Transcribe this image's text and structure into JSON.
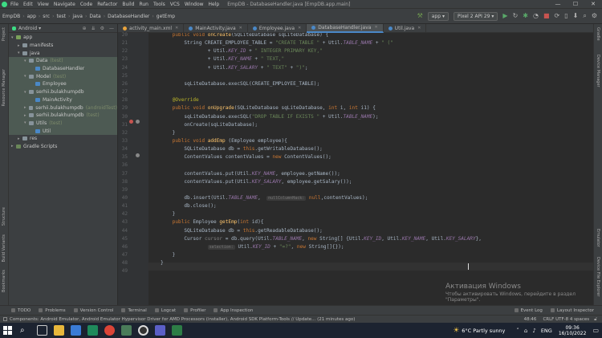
{
  "menu": {
    "app_icon": "android-studio-icon",
    "items": [
      "File",
      "Edit",
      "View",
      "Navigate",
      "Code",
      "Refactor",
      "Build",
      "Run",
      "Tools",
      "VCS",
      "Window",
      "Help"
    ],
    "title": "EmpDB - DatabaseHandler.java [EmpDB.app.main]",
    "window_controls": [
      "—",
      "☐",
      "✕"
    ]
  },
  "nav": {
    "breadcrumbs": [
      "EmpDB",
      "app",
      "src",
      "test",
      "java",
      "Data",
      "DatabaseHandler",
      "getEmp"
    ],
    "config": "app",
    "device": "Pixel 2 API 29"
  },
  "left_stripe": {
    "labels": [
      "Project",
      "Resource Manager",
      "Structure",
      "Build Variants",
      "Bookmarks"
    ]
  },
  "right_stripe": {
    "labels": [
      "Gradle",
      "Device Manager",
      "Emulator",
      "Device File Explorer"
    ]
  },
  "project": {
    "selector": "Android",
    "tree": [
      {
        "label": "app",
        "secondary": "",
        "depth": 0,
        "arrow": "▾",
        "icon": "#7aa05a",
        "sel": false
      },
      {
        "label": "manifests",
        "secondary": "",
        "depth": 1,
        "arrow": "▸",
        "icon": "#87939a",
        "sel": false
      },
      {
        "label": "java",
        "secondary": "",
        "depth": 1,
        "arrow": "▾",
        "icon": "#87939a",
        "sel": false
      },
      {
        "label": "Data",
        "secondary": "(test)",
        "depth": 2,
        "arrow": "▾",
        "icon": "#87939a",
        "sel": true
      },
      {
        "label": "DatabaseHandler",
        "secondary": "",
        "depth": 3,
        "arrow": "",
        "icon": "#4a88c7",
        "sel": true
      },
      {
        "label": "Model",
        "secondary": "(test)",
        "depth": 2,
        "arrow": "▾",
        "icon": "#87939a",
        "sel": true
      },
      {
        "label": "Employee",
        "secondary": "",
        "depth": 3,
        "arrow": "",
        "icon": "#4a88c7",
        "sel": true
      },
      {
        "label": "serhii.bulakhumpdb",
        "secondary": "",
        "depth": 2,
        "arrow": "▾",
        "icon": "#87939a",
        "sel": true
      },
      {
        "label": "MainActivity",
        "secondary": "",
        "depth": 3,
        "arrow": "",
        "icon": "#4a88c7",
        "sel": true
      },
      {
        "label": "serhii.bulakhumpdb",
        "secondary": "(androidTest)",
        "depth": 2,
        "arrow": "▸",
        "icon": "#87939a",
        "sel": true
      },
      {
        "label": "serhii.bulakhumpdb",
        "secondary": "(test)",
        "depth": 2,
        "arrow": "▸",
        "icon": "#87939a",
        "sel": true
      },
      {
        "label": "Utils",
        "secondary": "(test)",
        "depth": 2,
        "arrow": "▾",
        "icon": "#87939a",
        "sel": true
      },
      {
        "label": "Util",
        "secondary": "",
        "depth": 3,
        "arrow": "",
        "icon": "#4a88c7",
        "sel": true
      },
      {
        "label": "res",
        "secondary": "",
        "depth": 1,
        "arrow": "▸",
        "icon": "#87939a",
        "sel": false
      },
      {
        "label": "Gradle Scripts",
        "secondary": "",
        "depth": 0,
        "arrow": "▸",
        "icon": "#6a8759",
        "sel": false
      }
    ]
  },
  "tabs": [
    {
      "label": "activity_main.xml",
      "active": false
    },
    {
      "label": "MainActivity.java",
      "active": false
    },
    {
      "label": "Employee.java",
      "active": false
    },
    {
      "label": "DatabaseHandler.java",
      "active": true
    },
    {
      "label": "Util.java",
      "active": false
    }
  ],
  "code": [
    {
      "n": "20",
      "html": "    <span class='kw'>public void</span> <span class='fn'>onCreate</span>(SQLiteDatabase sqLiteDatabase) {"
    },
    {
      "n": "21",
      "html": "        String CREATE_EMPLOYEE_TABLE = <span class='str'>\"CREATE TABLE \"</span> + Util.<span class='fld'>TABLE_NAME</span> + <span class='str'>\" (\"</span>"
    },
    {
      "n": "22",
      "html": "                + Util.<span class='fld'>KEY_ID</span> + <span class='str'>\" INTEGER PRIMARY KEY,\"</span>"
    },
    {
      "n": "23",
      "html": "                + Util.<span class='fld'>KEY_NAME</span> + <span class='str'>\" TEXT,\"</span>"
    },
    {
      "n": "24",
      "html": "                + Util.<span class='fld'>KEY_SALARY</span> + <span class='str'>\" TEXT\"</span> + <span class='str'>\")\"</span>;"
    },
    {
      "n": "25",
      "html": ""
    },
    {
      "n": "26",
      "html": "        sqLiteDatabase.execSQL(CREATE_EMPLOYEE_TABLE);"
    },
    {
      "n": "27",
      "html": ""
    },
    {
      "n": "28",
      "html": "    <span class='ann'>@Override</span>"
    },
    {
      "n": "29",
      "html": "    <span class='kw'>public void</span> <span class='fn'>onUpgrade</span>(SQLiteDatabase sqLiteDatabase, <span class='kw'>int</span> i, <span class='kw'>int</span> i1) {"
    },
    {
      "n": "30",
      "html": "        sqLiteDatabase.execSQL(<span class='str'>\"DROP TABLE IF EXISTS \"</span> + Util.<span class='fld'>TABLE_NAME</span>);"
    },
    {
      "n": "31",
      "html": "        onCreate(sqLiteDatabase);"
    },
    {
      "n": "32",
      "html": "    }"
    },
    {
      "n": "33",
      "html": "    <span class='kw'>public void</span> <span class='fn'>addEmp</span> (Employee employee){"
    },
    {
      "n": "34",
      "html": "        SQLiteDatabase db = <span class='kw'>this</span>.getWritableDatabase();"
    },
    {
      "n": "35",
      "html": "        ContentValues contentValues = <span class='kw'>new</span> ContentValues();"
    },
    {
      "n": "36",
      "html": ""
    },
    {
      "n": "37",
      "html": "        contentValues.put(Util.<span class='fld'>KEY_NAME</span>, employee.getName());"
    },
    {
      "n": "38",
      "html": "        contentValues.put(Util.<span class='fld'>KEY_SALARY</span>, employee.getSalary());"
    },
    {
      "n": "39",
      "html": ""
    },
    {
      "n": "40",
      "html": "        db.insert(Util.<span class='fld'>TABLE_NAME</span>,  <span class='hint'>nullColumnHack:</span> <span class='kw'>null</span>,contentValues);"
    },
    {
      "n": "41",
      "html": "        db.close();"
    },
    {
      "n": "42",
      "html": "    }"
    },
    {
      "n": "43",
      "html": "    <span class='kw'>public</span> Employee <span class='fn'>getEmp</span>(<span class='kw'>int</span> id){"
    },
    {
      "n": "44",
      "html": "        SQLiteDatabase db = <span class='kw'>this</span>.getReadableDatabase();"
    },
    {
      "n": "45",
      "html": "        Cursor <span class='cmt'>cursor</span> = db.query(Util.<span class='fld'>TABLE_NAME</span>, <span class='kw'>new</span> String[] {Util.<span class='fld'>KEY_ID</span>, Util.<span class='fld'>KEY_NAME</span>, Util.<span class='fld'>KEY_SALARY</span>},"
    },
    {
      "n": "46",
      "html": "                <span class='hint'>selection:</span> Util.<span class='fld'>KEY_ID</span> + <span class='str'>\"=?\"</span>, <span class='kw'>new</span> String[]{});"
    },
    {
      "n": "47",
      "html": "    }"
    },
    {
      "n": "48",
      "html": "}"
    },
    {
      "n": "49",
      "html": ""
    }
  ],
  "watermark": {
    "title": "Активация Windows",
    "line1": "Чтобы активировать Windows, перейдите в раздел",
    "line2": "\"Параметры\"."
  },
  "tool_tabs": [
    "TODO",
    "Problems",
    "Version Control",
    "Terminal",
    "Logcat",
    "Profiler",
    "App Inspection"
  ],
  "tool_tabs_right": [
    "Event Log",
    "Layout Inspector"
  ],
  "status": {
    "message": "Components: Android Emulator, Android Emulator Hypervisor Driver for AMD Processors (installer), Android SDK Platform-Tools // Update... (21 minutes ago)",
    "position": "48:46",
    "encoding": "CRLF  UTF-8  4 spaces"
  },
  "taskbar": {
    "weather": "6°C  Partly sunny",
    "lang": "ENG",
    "time": "09:36",
    "date": "16/10/2022"
  }
}
